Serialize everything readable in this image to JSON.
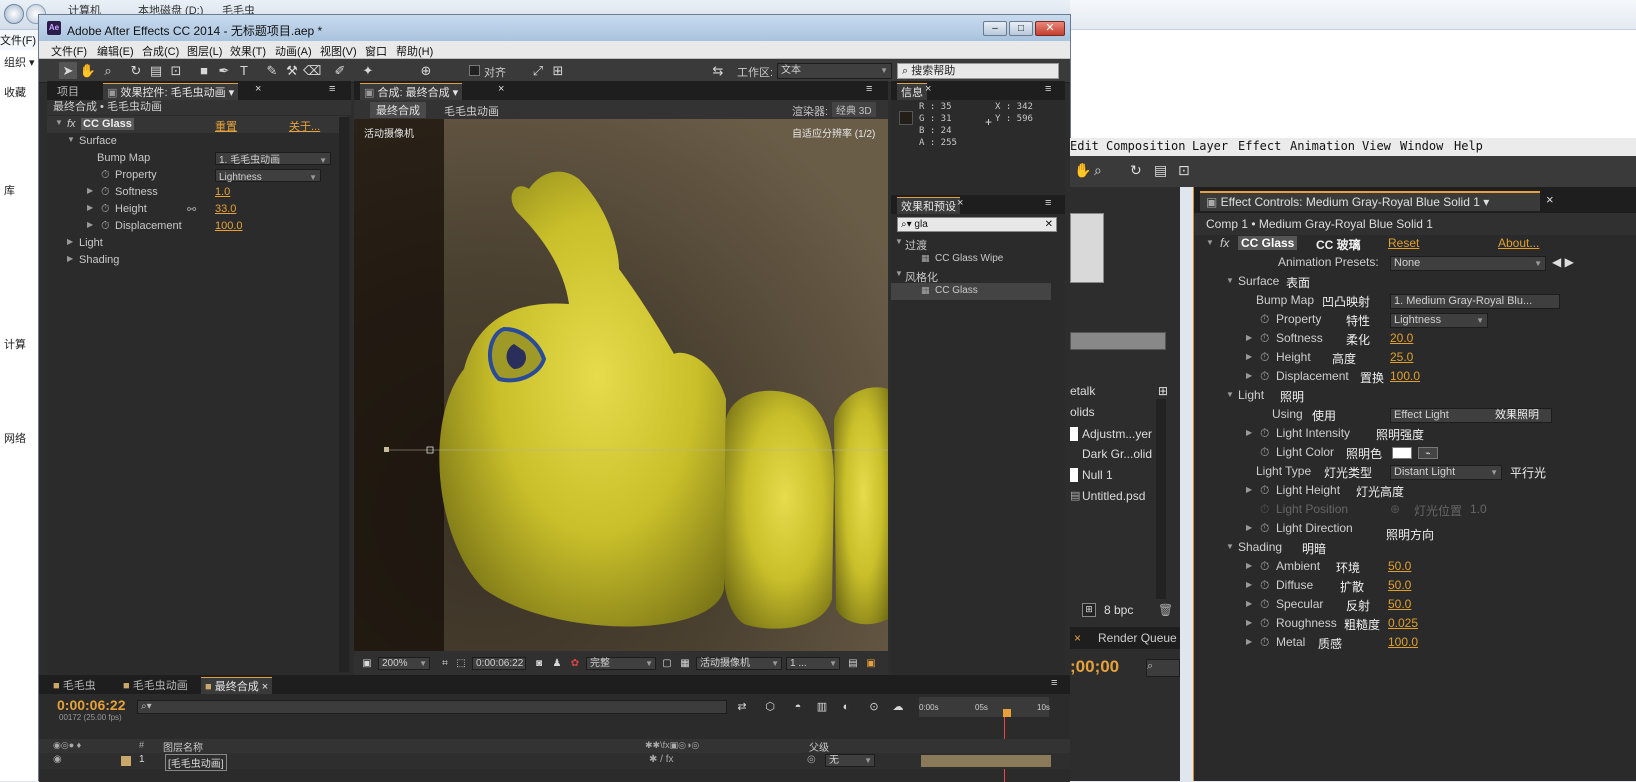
{
  "explorer": {
    "breadcrumb": [
      "计算机",
      "本地磁盘 (D:)",
      "毛毛虫"
    ],
    "menu_file": "文件(F)",
    "organize": "组织 ▾",
    "sidebar": [
      "收藏",
      "库",
      "计算",
      "网络"
    ]
  },
  "ae": {
    "title": "Adobe After Effects CC 2014 - 无标题项目.aep *",
    "menus": [
      "文件(F)",
      "编辑(E)",
      "合成(C)",
      "图层(L)",
      "效果(T)",
      "动画(A)",
      "视图(V)",
      "窗口",
      "帮助(H)"
    ],
    "toolbar": {
      "align_label": "对齐",
      "workspace_label": "工作区:",
      "workspace_value": "文本",
      "search_placeholder": "搜索帮助"
    },
    "effect_controls": {
      "tab_project": "项目",
      "tab_label": "效果控件: 毛毛虫动画",
      "breadcrumb": "最终合成 • 毛毛虫动画",
      "effect_name": "CC Glass",
      "reset": "重置",
      "about": "关于...",
      "rows": [
        {
          "label": "Surface"
        },
        {
          "label": "Bump Map",
          "value": "1. 毛毛虫动画"
        },
        {
          "label": "Property",
          "value": "Lightness"
        },
        {
          "label": "Softness",
          "value": "1.0"
        },
        {
          "label": "Height",
          "value": "33.0"
        },
        {
          "label": "Displacement",
          "value": "100.0"
        },
        {
          "label": "Light"
        },
        {
          "label": "Shading"
        }
      ]
    },
    "viewer": {
      "tab_label": "合成: 最终合成",
      "crumb1": "最终合成",
      "crumb2": "毛毛虫动画",
      "renderer_label": "渲染器:",
      "renderer_value": "经典 3D",
      "camera_label": "活动摄像机",
      "resolution_label": "自适应分辨率 (1/2)",
      "zoom": "200%",
      "timecode": "0:00:06:22",
      "quality": "完整",
      "camera_select": "活动摄像机",
      "views": "1 ..."
    },
    "info": {
      "tab": "信息",
      "r": "R : 35",
      "g": "G : 31",
      "b": "B : 24",
      "a": "A : 255",
      "x": "X : 342",
      "y": "Y : 596"
    },
    "effects_presets": {
      "tab": "效果和预设",
      "search_value": "gla",
      "groups": [
        {
          "name": "过渡",
          "items": [
            "CC Glass Wipe"
          ]
        },
        {
          "name": "风格化",
          "items": [
            "CC Glass"
          ]
        }
      ]
    },
    "timeline": {
      "tabs": [
        "毛毛虫",
        "毛毛虫动画",
        "最终合成"
      ],
      "timecode": "0:00:06:22",
      "frames": "00172 (25.00 fps)",
      "col_layer_name": "图层名称",
      "col_parent": "父级",
      "layer_num": "1",
      "layer_name": "[毛毛虫动画]",
      "parent_value": "无",
      "ruler": [
        "0:00s",
        "05s",
        "10s"
      ]
    }
  },
  "ae2": {
    "menus": [
      "Edit",
      "Composition",
      "Layer",
      "Effect",
      "Animation",
      "View",
      "Window",
      "Help"
    ],
    "project_items": [
      "etalk",
      "olids",
      "Adjustm...yer",
      "Dark Gr...olid",
      "Null 1",
      "Untitled.psd"
    ],
    "bpc": "8 bpc",
    "render_queue": "Render Queue",
    "timecode": ";00;00",
    "effect_controls": {
      "tab_label": "Effect Controls: Medium Gray-Royal Blue Solid 1",
      "breadcrumb": "Comp 1 • Medium Gray-Royal Blue Solid 1",
      "effect_name": "CC Glass",
      "effect_name_cn": "CC 玻璃",
      "reset": "Reset",
      "about": "About...",
      "anim_presets_label": "Animation Presets:",
      "anim_presets_value": "None",
      "rows": [
        {
          "label": "Surface",
          "cn": "表面"
        },
        {
          "label": "Bump Map",
          "cn": "凹凸映射",
          "value": "1. Medium Gray-Royal Blu..."
        },
        {
          "label": "Property",
          "cn": "特性",
          "value": "Lightness"
        },
        {
          "label": "Softness",
          "cn": "柔化",
          "value": "20.0"
        },
        {
          "label": "Height",
          "cn": "高度",
          "value": "25.0"
        },
        {
          "label": "Displacement",
          "cn": "置换",
          "value": "100.0"
        },
        {
          "label": "Light",
          "cn": "照明"
        },
        {
          "label": "Using",
          "cn": "使用",
          "value": "Effect Light",
          "value_cn": "效果照明"
        },
        {
          "label": "Light Intensity",
          "cn": "照明强度"
        },
        {
          "label": "Light Color",
          "cn": "照明色"
        },
        {
          "label": "Light Type",
          "cn": "灯光类型",
          "value": "Distant Light",
          "value_cn": "平行光"
        },
        {
          "label": "Light Height",
          "cn": "灯光高度"
        },
        {
          "label": "Light Position",
          "cn": "灯光位置",
          "value": "1.0"
        },
        {
          "label": "Light Direction",
          "cn": "照明方向"
        },
        {
          "label": "Shading",
          "cn": "明暗"
        },
        {
          "label": "Ambient",
          "cn": "环境",
          "value": "50.0"
        },
        {
          "label": "Diffuse",
          "cn": "扩散",
          "value": "50.0"
        },
        {
          "label": "Specular",
          "cn": "反射",
          "value": "50.0"
        },
        {
          "label": "Roughness",
          "cn": "粗糙度",
          "value": "0.025"
        },
        {
          "label": "Metal",
          "cn": "质感",
          "value": "100.0"
        }
      ]
    }
  },
  "colors": {
    "accent": "#e6a23a",
    "panel": "#2b2b2b",
    "caterpillar": "#c9c23a"
  }
}
